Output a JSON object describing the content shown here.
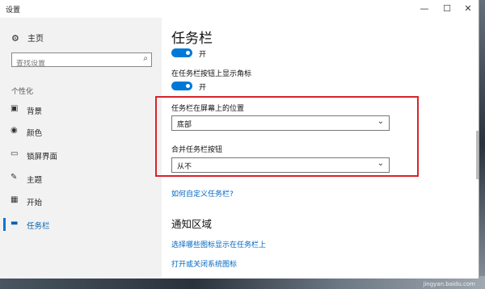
{
  "window": {
    "title": "设置",
    "controls": {
      "minimize": "—",
      "maximize": "☐",
      "close": "✕"
    }
  },
  "sidebar": {
    "home": {
      "label": "主页",
      "icon": "gear-icon"
    },
    "search": {
      "placeholder": "查找设置",
      "value": ""
    },
    "section": "个性化",
    "items": [
      {
        "label": "背景",
        "icon": "picture-icon"
      },
      {
        "label": "颜色",
        "icon": "palette-icon"
      },
      {
        "label": "锁屏界面",
        "icon": "lock-screen-icon"
      },
      {
        "label": "主题",
        "icon": "theme-icon"
      },
      {
        "label": "开始",
        "icon": "start-icon"
      },
      {
        "label": "任务栏",
        "icon": "taskbar-icon",
        "active": true
      }
    ]
  },
  "main": {
    "title": "任务栏",
    "toggle1": {
      "state": "开",
      "on": true
    },
    "badge_setting": {
      "label": "在任务栏按钮上显示角标"
    },
    "toggle2": {
      "state": "开",
      "on": true
    },
    "position": {
      "label": "任务栏在屏幕上的位置",
      "value": "底部"
    },
    "combine": {
      "label": "合并任务栏按钮",
      "value": "从不"
    },
    "customize_link": "如何自定义任务栏?",
    "notification_section": "通知区域",
    "link_icons": "选择哪些图标显示在任务栏上",
    "link_system_icons": "打开或关闭系统图标"
  },
  "watermark": {
    "text": "Baidu 经验",
    "sub": "jingyan.baidu.com"
  },
  "colors": {
    "accent": "#0078d7",
    "highlight": "#d9232a",
    "link": "#0067c0"
  }
}
